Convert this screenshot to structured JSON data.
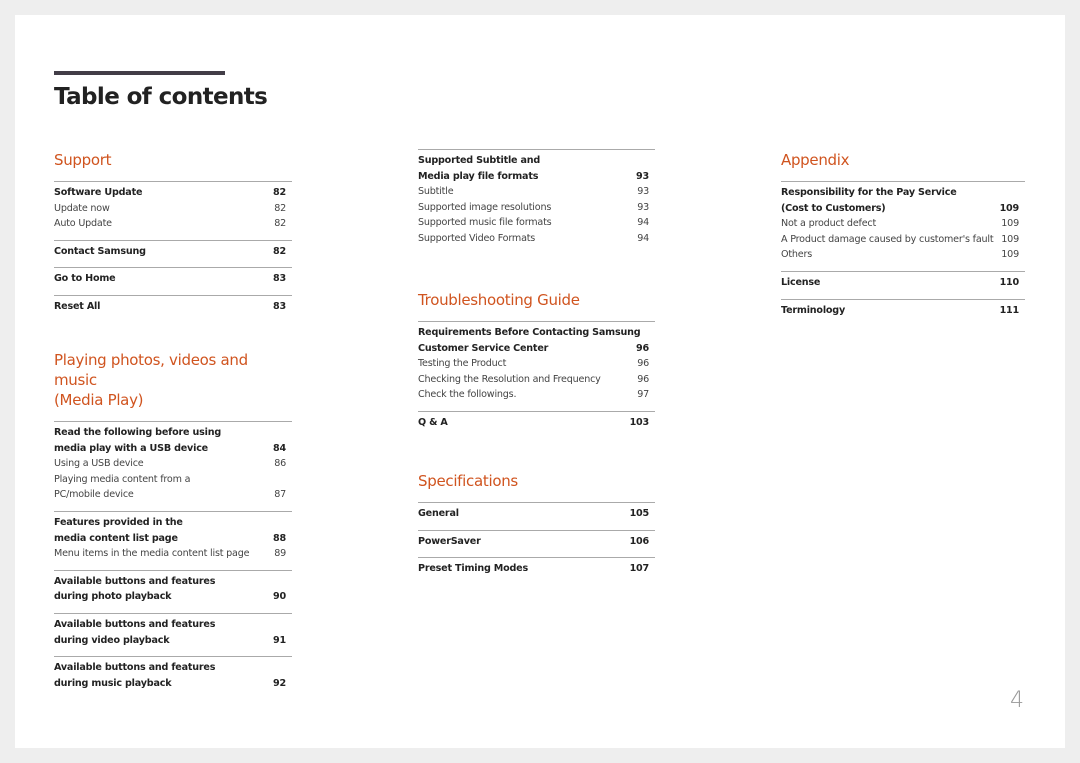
{
  "title": "Table of contents",
  "page_number": "4",
  "accent_color": "#d0541f",
  "columns": [
    {
      "sections": [
        {
          "title": [
            "Support"
          ],
          "groups": [
            {
              "rows": [
                {
                  "lines": [
                    "Software Update"
                  ],
                  "page": "82",
                  "bold": true
                },
                {
                  "lines": [
                    "Update now"
                  ],
                  "page": "82"
                },
                {
                  "lines": [
                    "Auto Update"
                  ],
                  "page": "82"
                }
              ]
            },
            {
              "rows": [
                {
                  "lines": [
                    "Contact Samsung"
                  ],
                  "page": "82",
                  "bold": true
                }
              ]
            },
            {
              "rows": [
                {
                  "lines": [
                    "Go to Home"
                  ],
                  "page": "83",
                  "bold": true
                }
              ]
            },
            {
              "rows": [
                {
                  "lines": [
                    "Reset All"
                  ],
                  "page": "83",
                  "bold": true
                }
              ]
            }
          ]
        },
        {
          "title": [
            "Playing photos, videos and music",
            "(Media Play)"
          ],
          "groups": [
            {
              "rows": [
                {
                  "lines": [
                    "Read the following before using",
                    "media play with a USB device"
                  ],
                  "page": "84",
                  "bold": true
                },
                {
                  "lines": [
                    "Using a USB device"
                  ],
                  "page": "86"
                },
                {
                  "lines": [
                    "Playing media content from a",
                    "PC/mobile device"
                  ],
                  "page": "87"
                }
              ]
            },
            {
              "rows": [
                {
                  "lines": [
                    "Features provided in the",
                    "media content list page"
                  ],
                  "page": "88",
                  "bold": true
                },
                {
                  "lines": [
                    "Menu items in the media content list page"
                  ],
                  "page": "89"
                }
              ]
            },
            {
              "rows": [
                {
                  "lines": [
                    "Available buttons and features",
                    "during photo playback"
                  ],
                  "page": "90",
                  "bold": true
                }
              ]
            },
            {
              "rows": [
                {
                  "lines": [
                    "Available buttons and features",
                    "during video playback"
                  ],
                  "page": "91",
                  "bold": true
                }
              ]
            },
            {
              "rows": [
                {
                  "lines": [
                    "Available buttons and features",
                    "during music playback"
                  ],
                  "page": "92",
                  "bold": true
                }
              ]
            }
          ]
        }
      ]
    },
    {
      "sections": [
        {
          "title": [],
          "groups": [
            {
              "rows": [
                {
                  "lines": [
                    "Supported Subtitle and",
                    "Media play file formats"
                  ],
                  "page": "93",
                  "bold": true
                },
                {
                  "lines": [
                    "Subtitle"
                  ],
                  "page": "93"
                },
                {
                  "lines": [
                    "Supported image resolutions"
                  ],
                  "page": "93"
                },
                {
                  "lines": [
                    "Supported music file formats"
                  ],
                  "page": "94"
                },
                {
                  "lines": [
                    "Supported Video Formats"
                  ],
                  "page": "94"
                }
              ]
            }
          ]
        },
        {
          "title": [
            "Troubleshooting Guide"
          ],
          "groups": [
            {
              "rows": [
                {
                  "lines": [
                    "Requirements Before Contacting Samsung",
                    "Customer Service Center"
                  ],
                  "page": "96",
                  "bold": true
                },
                {
                  "lines": [
                    "Testing the Product"
                  ],
                  "page": "96"
                },
                {
                  "lines": [
                    "Checking the Resolution and Frequency"
                  ],
                  "page": "96"
                },
                {
                  "lines": [
                    "Check the followings."
                  ],
                  "page": "97"
                }
              ]
            },
            {
              "rows": [
                {
                  "lines": [
                    "Q & A"
                  ],
                  "page": "103",
                  "bold": true
                }
              ]
            }
          ]
        },
        {
          "title": [
            "Specifications"
          ],
          "groups": [
            {
              "rows": [
                {
                  "lines": [
                    "General"
                  ],
                  "page": "105",
                  "bold": true
                }
              ]
            },
            {
              "rows": [
                {
                  "lines": [
                    "PowerSaver"
                  ],
                  "page": "106",
                  "bold": true
                }
              ]
            },
            {
              "rows": [
                {
                  "lines": [
                    "Preset Timing Modes"
                  ],
                  "page": "107",
                  "bold": true
                }
              ]
            }
          ]
        }
      ]
    },
    {
      "sections": [
        {
          "title": [
            "Appendix"
          ],
          "groups": [
            {
              "rows": [
                {
                  "lines": [
                    "Responsibility for the Pay Service",
                    "(Cost to Customers)"
                  ],
                  "page": "109",
                  "bold": true
                },
                {
                  "lines": [
                    "Not a product defect"
                  ],
                  "page": "109"
                },
                {
                  "lines": [
                    "A Product damage caused by customer's fault"
                  ],
                  "page": "109"
                },
                {
                  "lines": [
                    "Others"
                  ],
                  "page": "109"
                }
              ]
            },
            {
              "rows": [
                {
                  "lines": [
                    "License"
                  ],
                  "page": "110",
                  "bold": true
                }
              ]
            },
            {
              "rows": [
                {
                  "lines": [
                    "Terminology"
                  ],
                  "page": "111",
                  "bold": true
                }
              ]
            }
          ]
        }
      ]
    }
  ]
}
